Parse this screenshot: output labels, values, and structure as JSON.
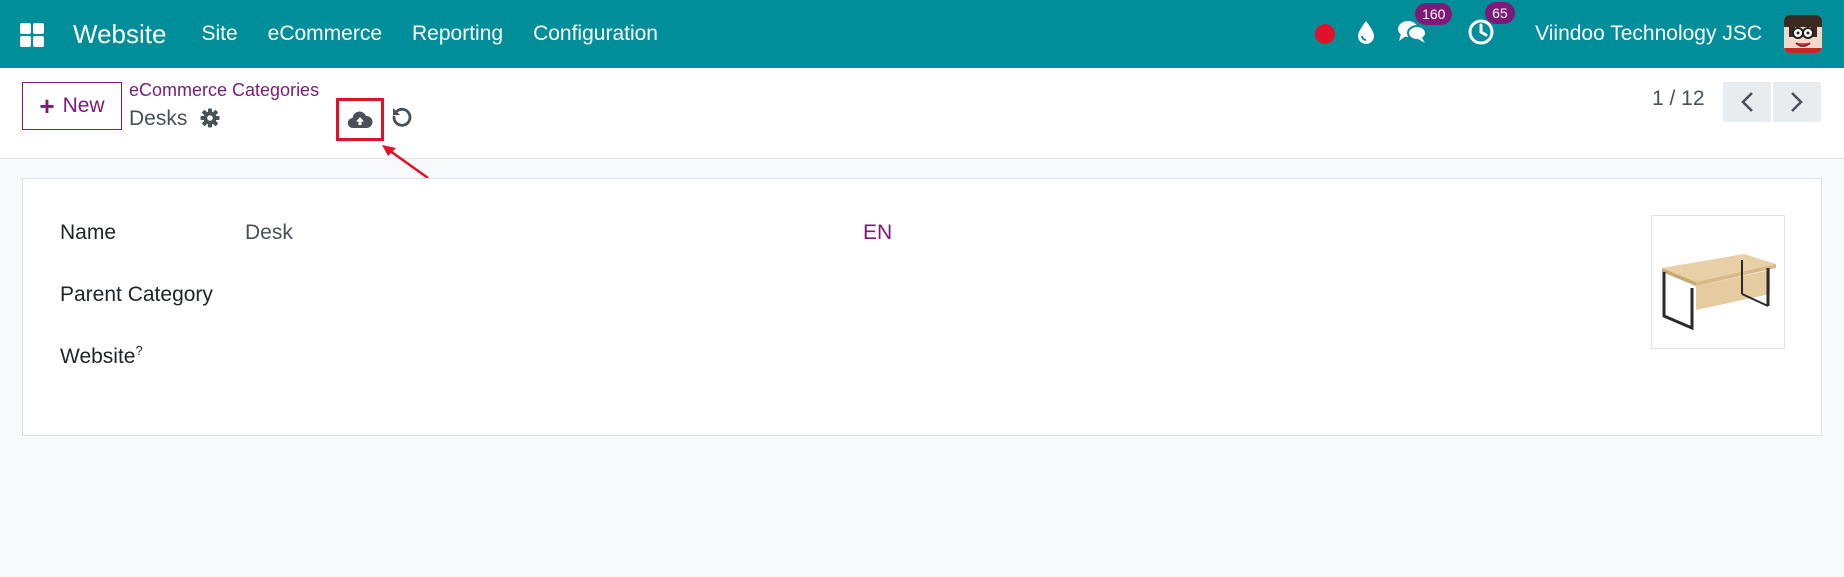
{
  "navbar": {
    "app_name": "Website",
    "menu": [
      "Site",
      "eCommerce",
      "Reporting",
      "Configuration"
    ],
    "messages_count": "160",
    "activities_count": "65",
    "company": "Viindoo Technology JSC"
  },
  "control_panel": {
    "new_label": "New",
    "breadcrumb_parent": "eCommerce Categories",
    "record_name": "Desks",
    "pager_value": "1 / 12"
  },
  "form": {
    "name_label": "Name",
    "name_value": "Desk",
    "lang_label": "EN",
    "parent_category_label": "Parent Category",
    "website_label": "Website",
    "website_help": "?"
  },
  "colors": {
    "navbar": "#008f9a",
    "accent": "#7d1a79",
    "highlight": "#e0112b"
  }
}
